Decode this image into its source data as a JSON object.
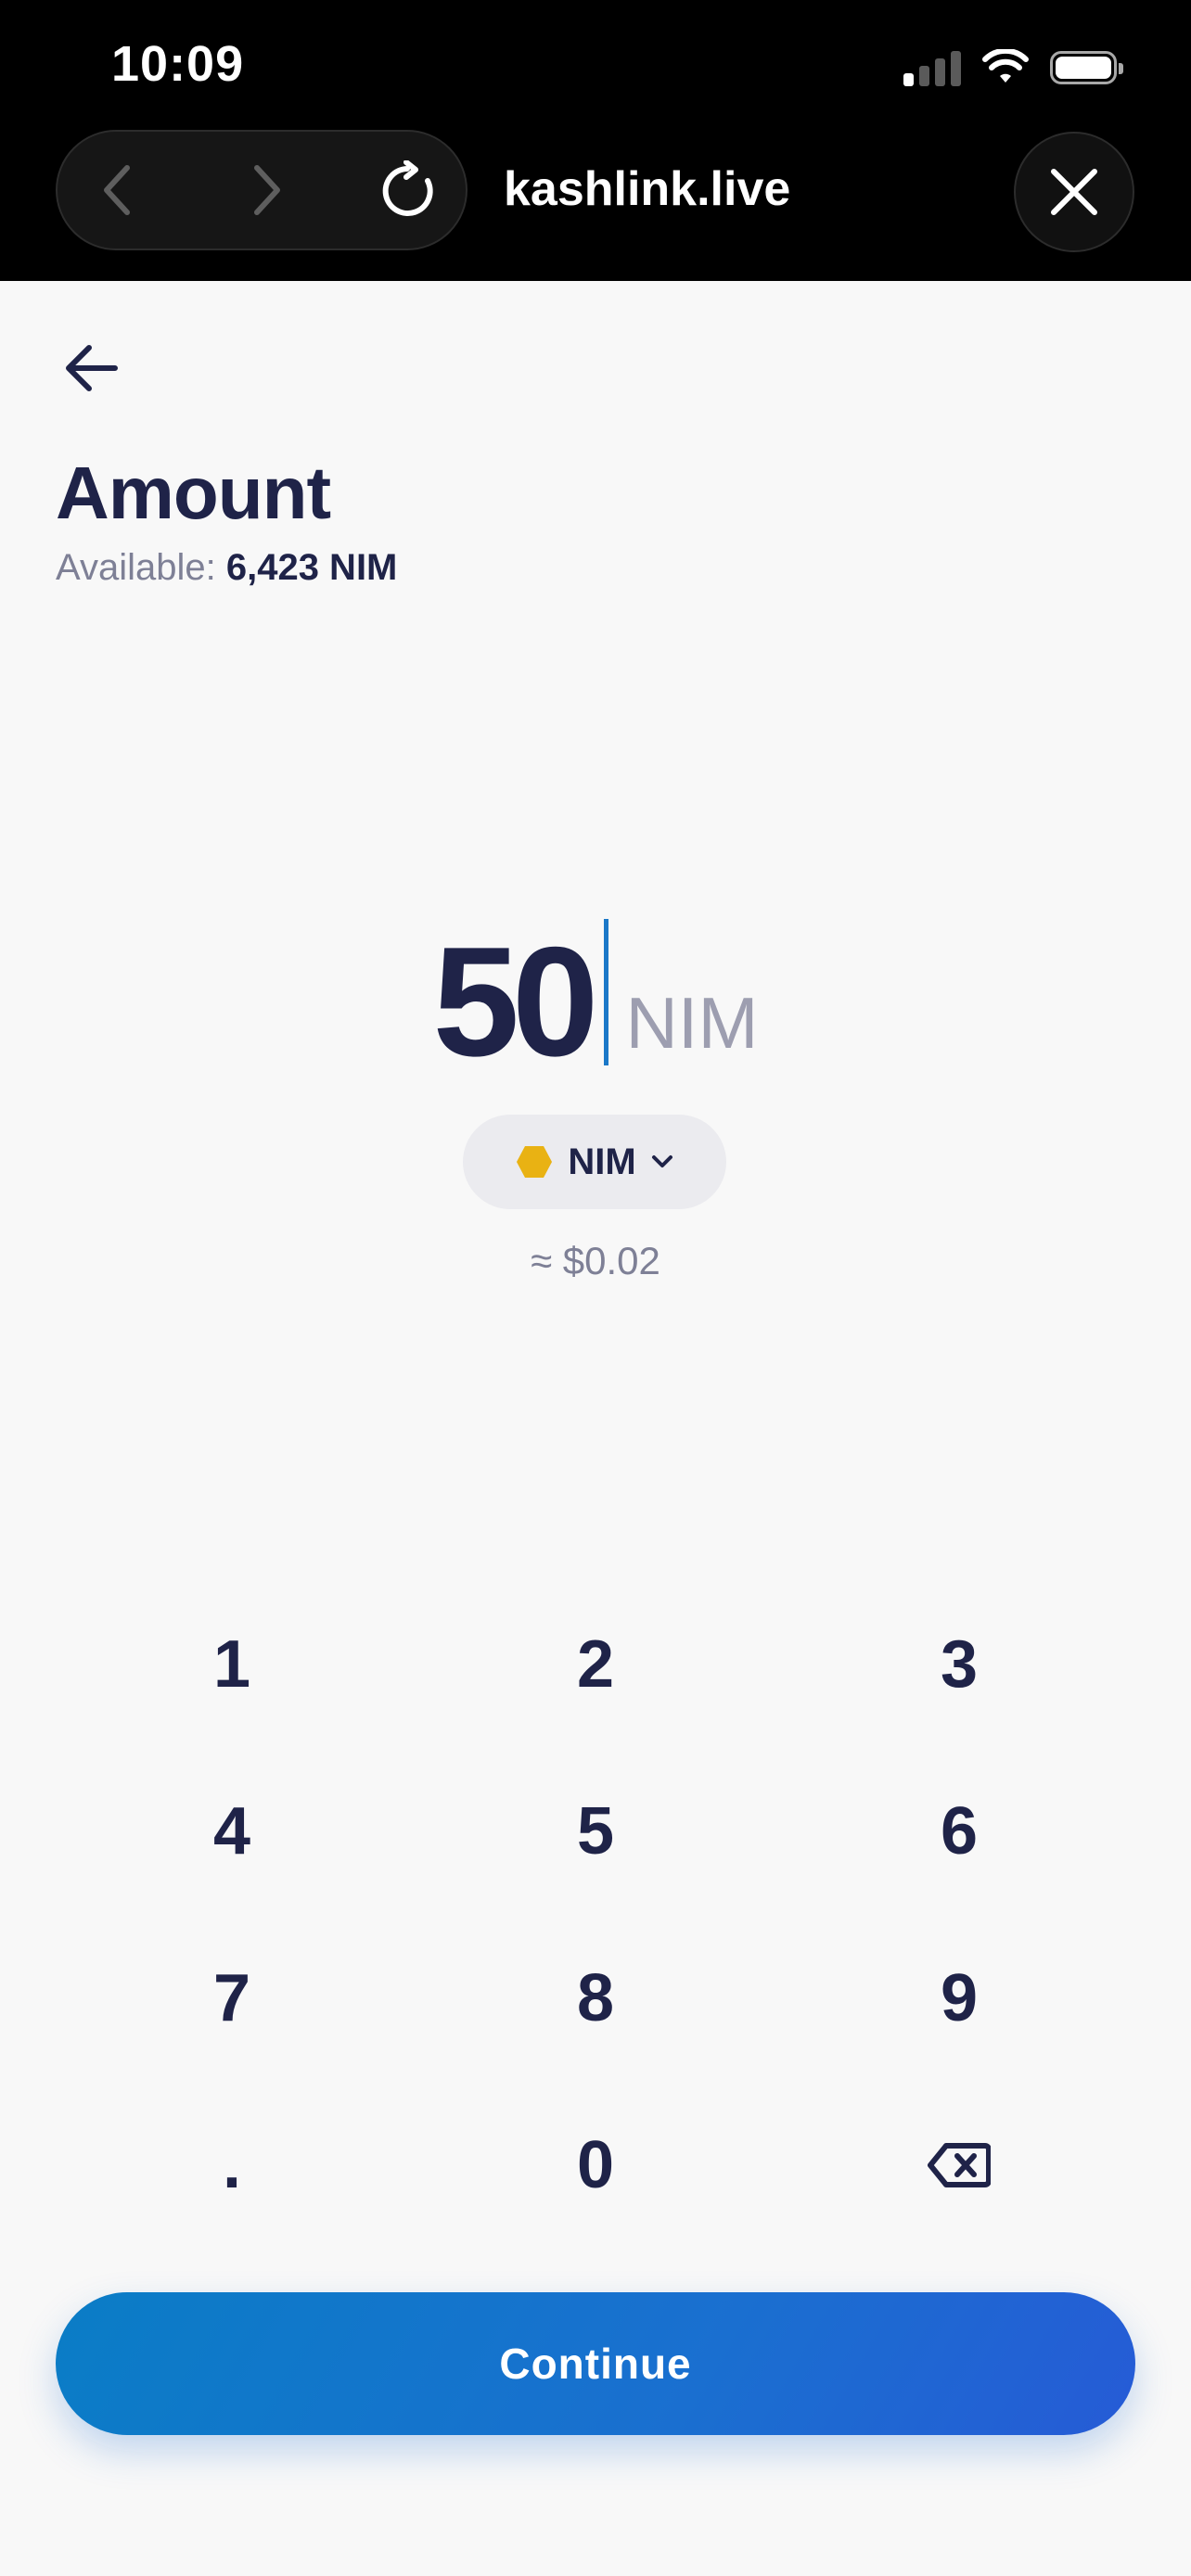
{
  "status_bar": {
    "time": "10:09"
  },
  "browser": {
    "url": "kashlink.live"
  },
  "page": {
    "title": "Amount",
    "available_label": "Available:",
    "available_value": "6,423 NIM"
  },
  "amount": {
    "value": "50",
    "unit": "NIM",
    "currency_selector": "NIM",
    "fiat_estimate": "≈ $0.02"
  },
  "keypad": {
    "keys": [
      "1",
      "2",
      "3",
      "4",
      "5",
      "6",
      "7",
      "8",
      "9",
      ".",
      "0"
    ]
  },
  "actions": {
    "continue_label": "Continue"
  },
  "colors": {
    "primary": "#0a7dc6",
    "text": "#1f2348",
    "muted": "#7e8096",
    "nim_coin": "#e9b213"
  }
}
